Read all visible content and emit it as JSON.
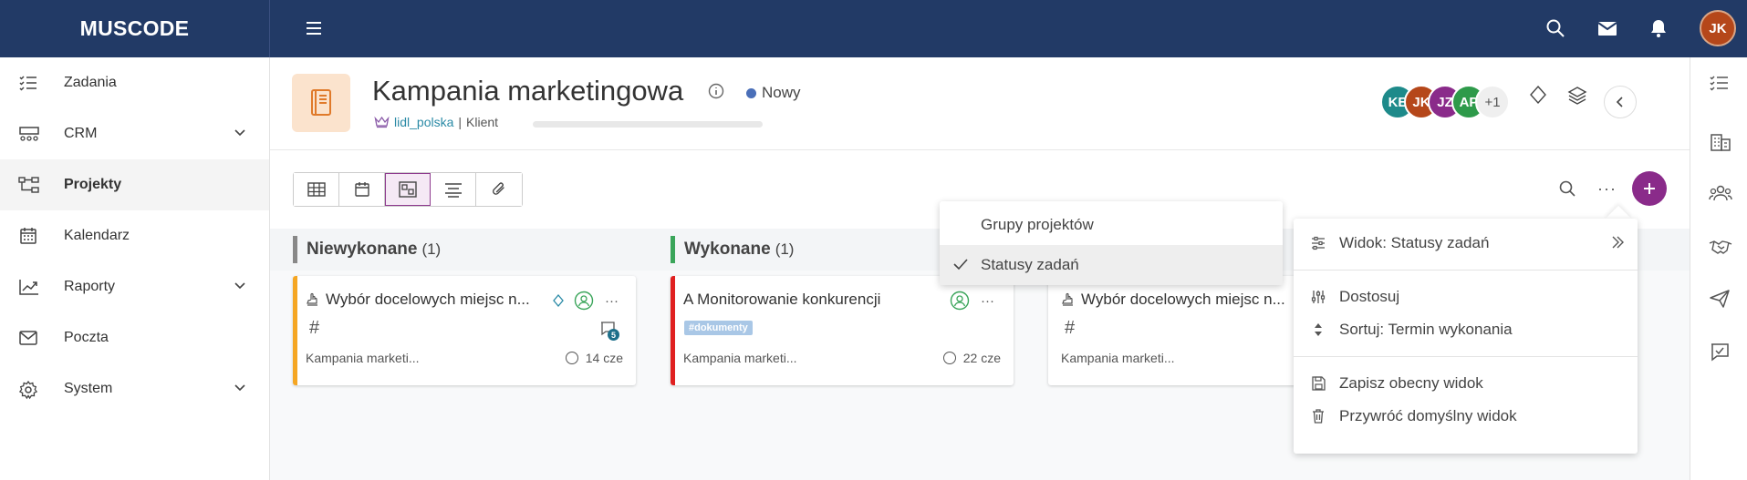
{
  "app": {
    "logo": "MUSCODE",
    "user_initials": "JK"
  },
  "sidebar": {
    "items": [
      {
        "label": "Zadania",
        "icon": "tasks-icon"
      },
      {
        "label": "CRM",
        "icon": "crm-icon",
        "expandable": true
      },
      {
        "label": "Projekty",
        "icon": "projects-icon",
        "active": true
      },
      {
        "label": "Kalendarz",
        "icon": "calendar-icon"
      },
      {
        "label": "Raporty",
        "icon": "reports-icon",
        "expandable": true
      },
      {
        "label": "Poczta",
        "icon": "mail-icon"
      },
      {
        "label": "System",
        "icon": "settings-icon",
        "expandable": true
      }
    ]
  },
  "header": {
    "title": "Kampania marketingowa",
    "status": "Nowy",
    "client_link": "lidl_polska",
    "client_label": "Klient",
    "avatars": [
      {
        "initials": "KE",
        "color": "#1e8a8a"
      },
      {
        "initials": "JK",
        "color": "#b5471a"
      },
      {
        "initials": "JZ",
        "color": "#8a2b8a"
      },
      {
        "initials": "AP",
        "color": "#2e9a4a"
      }
    ],
    "avatars_more": "+1"
  },
  "columns": [
    {
      "title": "Niewykonane",
      "count": "(1)",
      "color": "#888888"
    },
    {
      "title": "Wykonane",
      "count": "(1)",
      "color": "#3aa55a"
    }
  ],
  "cards": [
    {
      "title": "Wybór docelowych miejsc n...",
      "project": "Kampania marketi...",
      "date": "14 cze",
      "comment_count": "5",
      "color": "#f5a623"
    },
    {
      "title": "A Monitorowanie konkurencji",
      "tag": "#dokumenty",
      "project": "Kampania marketi...",
      "date": "22 cze",
      "color": "#e02020"
    },
    {
      "title": "Wybór docelowych miejsc n...",
      "project": "Kampania marketi..."
    }
  ],
  "group_menu": {
    "items": [
      "Grupy projektów",
      "Statusy zadań"
    ],
    "selected": "Statusy zadań"
  },
  "view_menu": {
    "view": "Widok: Statusy zadań",
    "customize": "Dostosuj",
    "sort": "Sortuj: Termin wykonania",
    "save": "Zapisz obecny widok",
    "restore": "Przywróć domyślny widok"
  },
  "colors": {
    "topbar": "#223a66",
    "accent": "#8a2b8a",
    "link": "#2a8aa6"
  }
}
